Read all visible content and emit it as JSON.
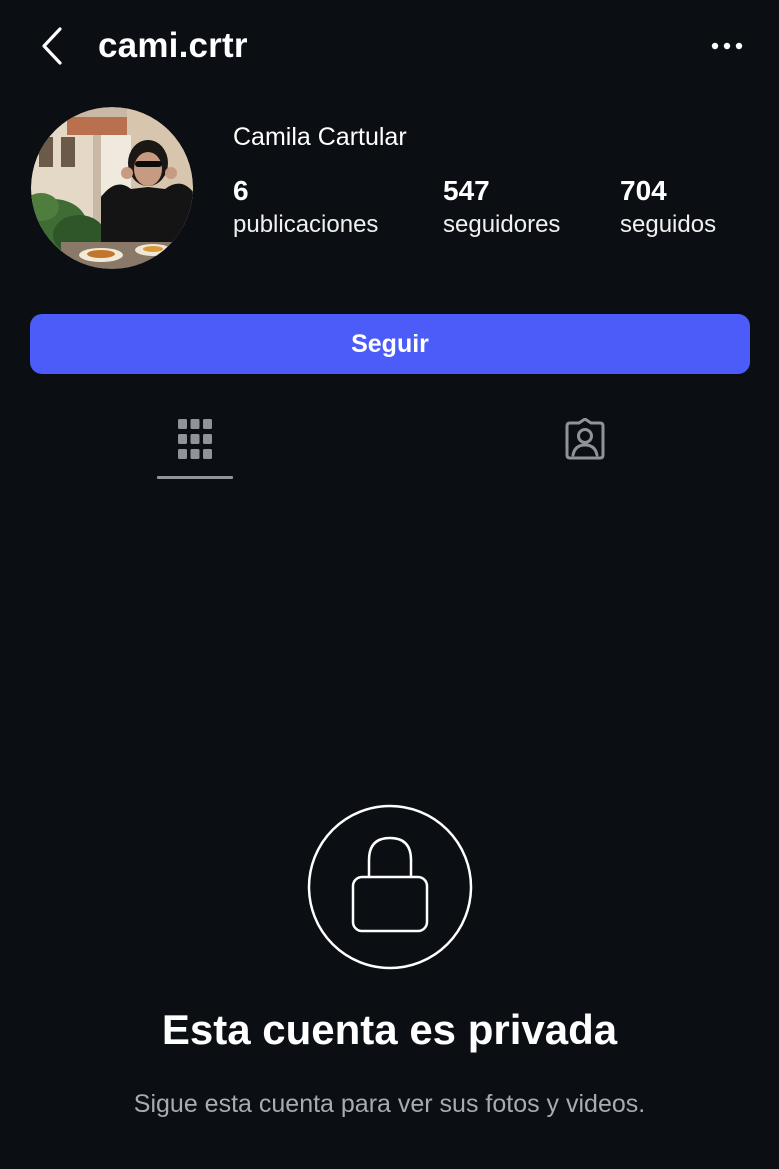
{
  "header": {
    "username": "cami.crtr",
    "back_icon": "chevron-left-icon",
    "more_icon": "more-horizontal-icon"
  },
  "profile": {
    "display_name": "Camila Cartular",
    "stats": {
      "posts": {
        "count": "6",
        "label": "publicaciones"
      },
      "followers": {
        "count": "547",
        "label": "seguidores"
      },
      "following": {
        "count": "704",
        "label": "seguidos"
      }
    }
  },
  "actions": {
    "follow_label": "Seguir"
  },
  "tabs": [
    {
      "name": "grid",
      "icon": "grid-icon",
      "active": true
    },
    {
      "name": "tagged",
      "icon": "tagged-person-icon",
      "active": false
    }
  ],
  "private_notice": {
    "icon": "lock-icon",
    "title": "Esta cuenta es privada",
    "subtitle": "Sigue esta cuenta para ver sus fotos y videos."
  },
  "colors": {
    "background": "#0b0f14",
    "accent": "#4c5cf8",
    "muted_text": "#a7abb2"
  }
}
